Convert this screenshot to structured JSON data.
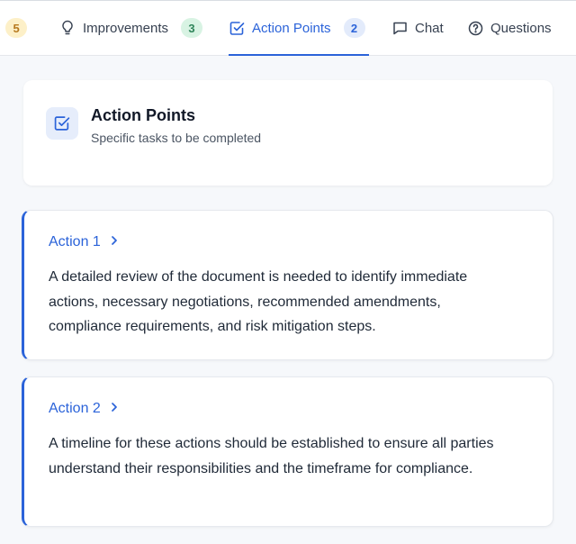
{
  "tabs": {
    "prev_badge": "5",
    "improvements": {
      "label": "Improvements",
      "badge": "3"
    },
    "action_points": {
      "label": "Action Points",
      "badge": "2"
    },
    "chat": {
      "label": "Chat"
    },
    "questions": {
      "label": "Questions"
    }
  },
  "header": {
    "title": "Action Points",
    "subtitle": "Specific tasks to be completed"
  },
  "actions": [
    {
      "title": "Action 1",
      "text": "A detailed review of the document is needed to identify immediate actions, necessary negotiations, recommended amendments, compliance requirements, and risk mitigation steps."
    },
    {
      "title": "Action 2",
      "text": "A timeline for these actions should be established to ensure all parties understand their responsibilities and the timeframe for compliance."
    }
  ],
  "colors": {
    "accent": "#2b63d9",
    "badge_yellow": "#fdf0c8",
    "badge_green": "#d8f3e3",
    "badge_blue": "#e3ebfb"
  },
  "icons": {
    "improvements": "lightbulb-icon",
    "action_points": "checkbox-icon",
    "chat": "chat-bubble-icon",
    "questions": "question-circle-icon",
    "action_expand": "chevron-right-icon"
  }
}
